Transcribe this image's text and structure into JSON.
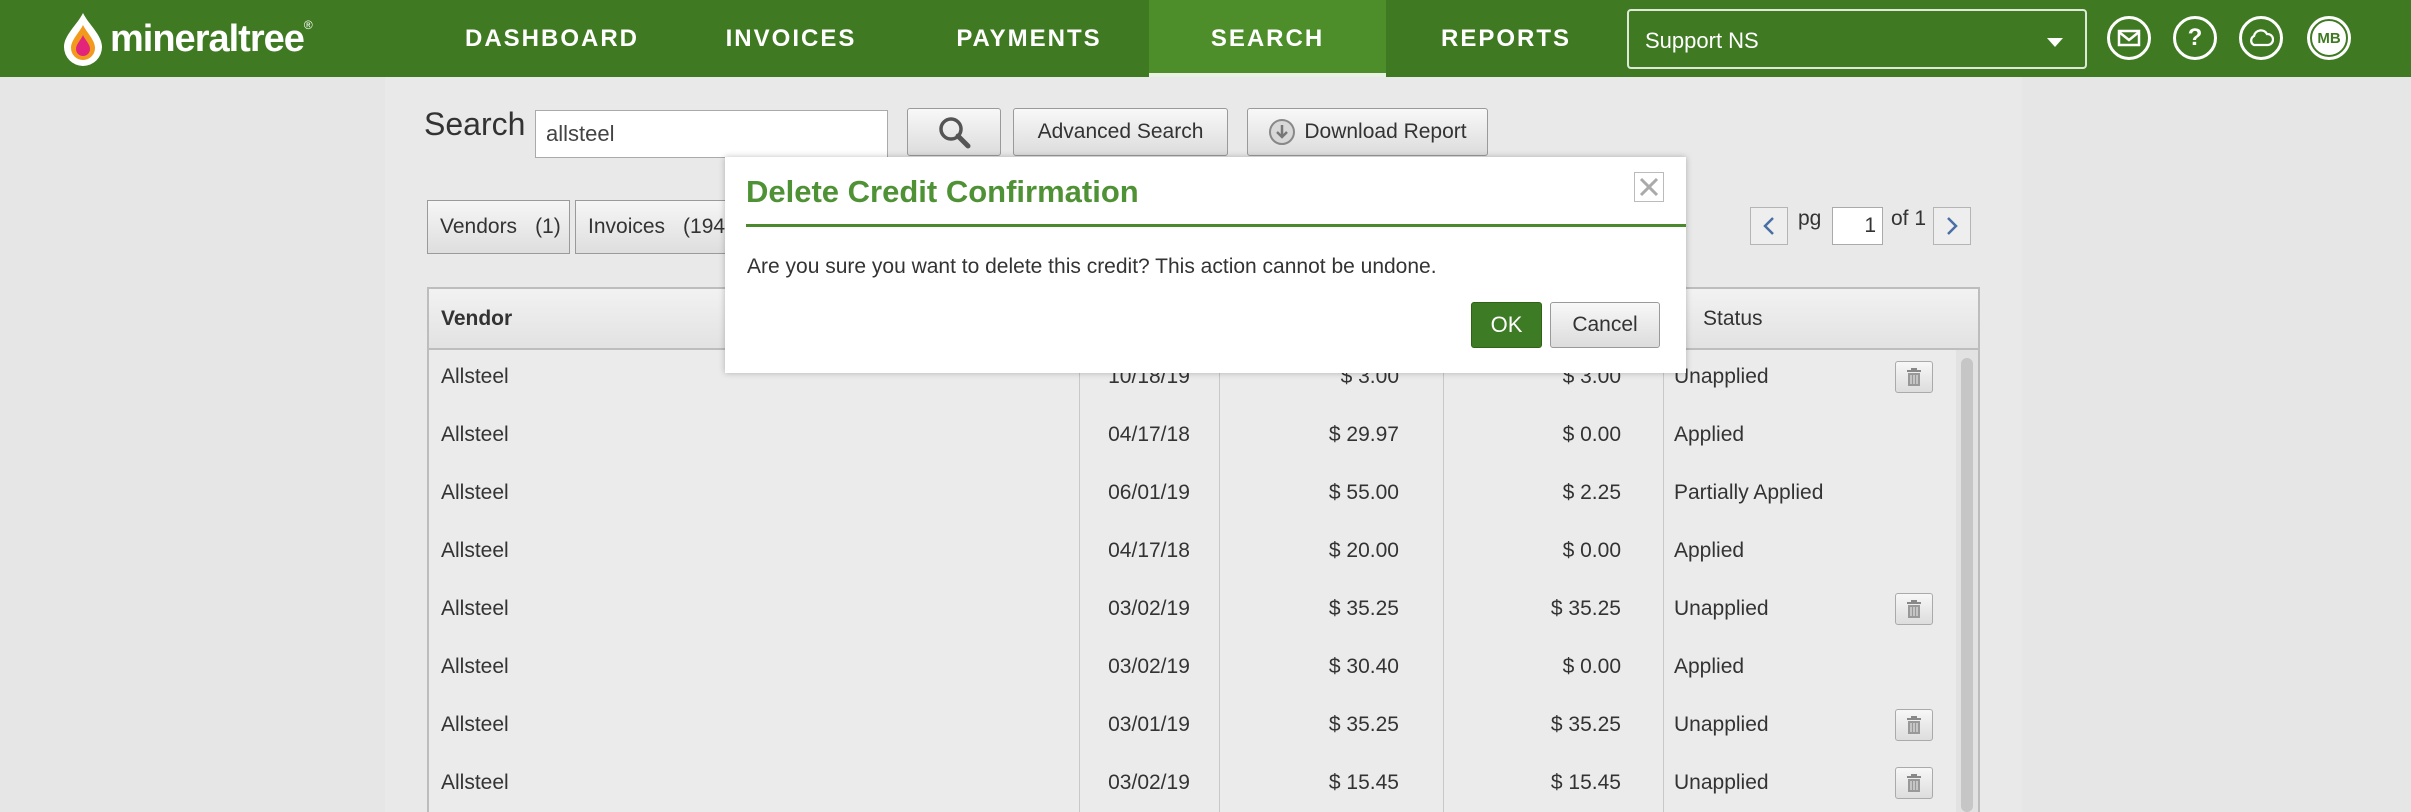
{
  "brand": {
    "name": "mineraltree",
    "reg": "®",
    "color": "#3f7a22"
  },
  "nav": {
    "items": [
      "DASHBOARD",
      "INVOICES",
      "PAYMENTS",
      "SEARCH",
      "REPORTS"
    ],
    "active": "SEARCH"
  },
  "account": {
    "selected": "Support NS"
  },
  "header_icons": [
    "mail-icon",
    "help-icon",
    "cloud-icon"
  ],
  "avatar": {
    "initials": "MB"
  },
  "search": {
    "label": "Search",
    "value": "allsteel",
    "advanced_label": "Advanced Search",
    "download_label": "Download Report"
  },
  "result_tabs": [
    {
      "label": "Vendors",
      "count": "(1)"
    },
    {
      "label": "Invoices",
      "count": "(194"
    }
  ],
  "pager": {
    "pg_label": "pg",
    "page": "1",
    "of_label": "of 1"
  },
  "table": {
    "columns": [
      "Vendor",
      "Status"
    ],
    "rows": [
      {
        "vendor": "Allsteel",
        "date": "10/18/19",
        "amount": "$ 3.00",
        "remaining": "$ 3.00",
        "status": "Unapplied",
        "deletable": true
      },
      {
        "vendor": "Allsteel",
        "date": "04/17/18",
        "amount": "$ 29.97",
        "remaining": "$ 0.00",
        "status": "Applied",
        "deletable": false
      },
      {
        "vendor": "Allsteel",
        "date": "06/01/19",
        "amount": "$ 55.00",
        "remaining": "$ 2.25",
        "status": "Partially Applied",
        "deletable": false
      },
      {
        "vendor": "Allsteel",
        "date": "04/17/18",
        "amount": "$ 20.00",
        "remaining": "$ 0.00",
        "status": "Applied",
        "deletable": false
      },
      {
        "vendor": "Allsteel",
        "date": "03/02/19",
        "amount": "$ 35.25",
        "remaining": "$ 35.25",
        "status": "Unapplied",
        "deletable": true
      },
      {
        "vendor": "Allsteel",
        "date": "03/02/19",
        "amount": "$ 30.40",
        "remaining": "$ 0.00",
        "status": "Applied",
        "deletable": false
      },
      {
        "vendor": "Allsteel",
        "date": "03/01/19",
        "amount": "$ 35.25",
        "remaining": "$ 35.25",
        "status": "Unapplied",
        "deletable": true
      },
      {
        "vendor": "Allsteel",
        "date": "03/02/19",
        "amount": "$ 15.45",
        "remaining": "$ 15.45",
        "status": "Unapplied",
        "deletable": true
      }
    ]
  },
  "modal": {
    "title": "Delete Credit Confirmation",
    "message": "Are you sure you want to delete this credit? This action cannot be undone.",
    "ok_label": "OK",
    "cancel_label": "Cancel"
  }
}
